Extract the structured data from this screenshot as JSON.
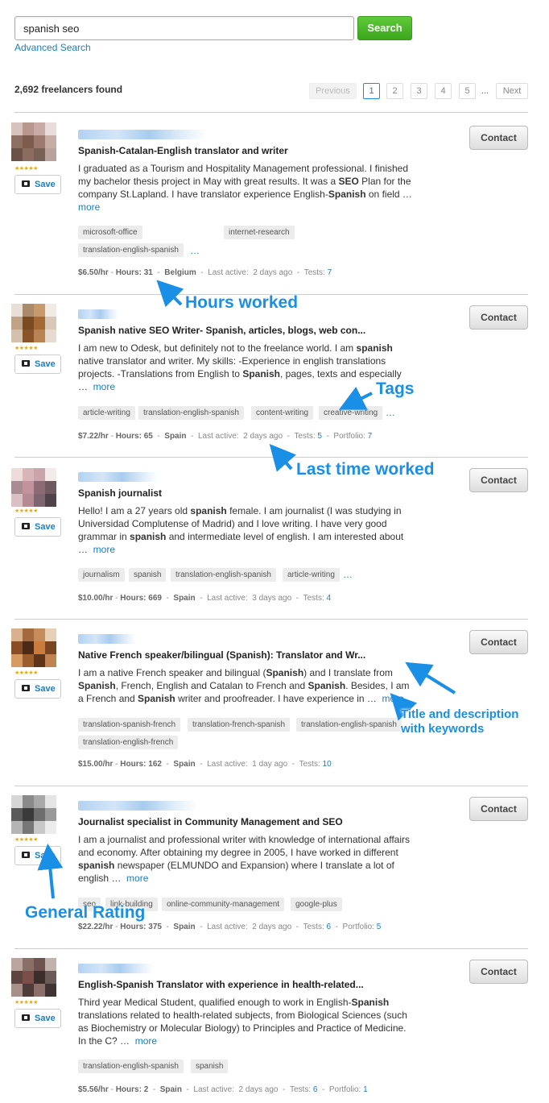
{
  "search": {
    "value": "spanish seo",
    "button": "Search",
    "advanced": "Advanced Search"
  },
  "results_count": "2,692 freelancers found",
  "pager": {
    "previous": "Previous",
    "pages": [
      "1",
      "2",
      "3",
      "4",
      "5"
    ],
    "dots": "...",
    "next": "Next",
    "current": "1"
  },
  "common": {
    "save": "Save",
    "contact": "Contact",
    "more": "more",
    "ellipsis": "…",
    "tags_more": "…",
    "stars": "★★★★★"
  },
  "freelancers": [
    {
      "title": "Spanish-Catalan-English translator and writer",
      "desc": [
        "I graduated as a Tourism and Hospitality Management professional. I finished my bachelor thesis project in May with great results. It was a ",
        "SEO",
        " Plan for the company St.Lapland. I have translator experience English-",
        "Spanish",
        " on field "
      ],
      "tags": [
        "microsoft-office",
        "internet-research",
        "translation-catalan-english",
        "translation-english-spanish"
      ],
      "rate": "$6.50/hr",
      "hours": "Hours: 31",
      "location": "Belgium",
      "last_active": "Last active:",
      "last_active_value": "2 days ago",
      "tests_label": "Tests:",
      "tests": "7"
    },
    {
      "title": "Spanish native SEO Writer- Spanish, articles, blogs, web con...",
      "desc": [
        "I am new to Odesk, but definitely not to the freelance world. I am ",
        "spanish",
        " native translator and writer. My skills: -Experience in english translations projects. -Translations from English to ",
        "Spanish",
        ", pages, texts and especially "
      ],
      "tags": [
        "article-writing",
        "translation-english-spanish",
        "content-writing",
        "creative-writing"
      ],
      "rate": "$7.22/hr",
      "hours": "Hours: 65",
      "location": "Spain",
      "last_active": "Last active:",
      "last_active_value": "2 days ago",
      "tests_label": "Tests:",
      "tests": "5",
      "portfolio_label": "Portfolio:",
      "portfolio": "7"
    },
    {
      "title": "Spanish journalist",
      "desc": [
        "Hello! I am a 27 years old ",
        "spanish",
        " female. I am journalist (I was studying in Universidad Complutense of Madrid) and I love writing. I have very good grammar in ",
        "spanish",
        " and intermediate level of english. I am interested about "
      ],
      "tags": [
        "journalism",
        "spanish",
        "translation-english-spanish",
        "article-writing"
      ],
      "rate": "$10.00/hr",
      "hours": "Hours: 669",
      "location": "Spain",
      "last_active": "Last active:",
      "last_active_value": "3 days ago",
      "tests_label": "Tests:",
      "tests": "4"
    },
    {
      "title": "Native French speaker/bilingual (Spanish): Translator and Wr...",
      "desc": [
        "I am a native French speaker and bilingual (",
        "Spanish",
        ") and I translate from ",
        "Spanish",
        ", French, English and Catalan to French and ",
        "Spanish",
        ". Besides, I am a French and ",
        "Spanish",
        " writer and proofreader. I have experience in "
      ],
      "tags": [
        "translation-spanish-french",
        "translation-french-spanish",
        "translation-english-spanish",
        "translation-english-french"
      ],
      "rate": "$15.00/hr",
      "hours": "Hours: 162",
      "location": "Spain",
      "last_active": "Last active:",
      "last_active_value": "1 day ago",
      "tests_label": "Tests:",
      "tests": "10"
    },
    {
      "title": "Journalist specialist in Community Management and SEO",
      "desc": [
        "I am a journalist and professional writer with knowledge of international affairs and economy. After obtaining my degree in 2005, I have worked in different ",
        "spanish",
        " newspaper (ELMUNDO and Expansion) where I translate a lot of english "
      ],
      "tags": [
        "seo",
        "link-building",
        "online-community-management",
        "google-plus"
      ],
      "rate": "$22.22/hr",
      "hours": "Hours: 375",
      "location": "Spain",
      "last_active": "Last active:",
      "last_active_value": "2 days ago",
      "tests_label": "Tests:",
      "tests": "6",
      "portfolio_label": "Portfolio:",
      "portfolio": "5"
    },
    {
      "title": "English-Spanish Translator with experience in health-related...",
      "desc": [
        "Third year Medical Student, qualified enough to work in English-",
        "Spanish",
        " translations related to health-related subjects, from Biological Sciences (such as Biochemistry or Molecular Biology) to Principles and Practice of Medicine. In the C? "
      ],
      "tags": [
        "translation-english-spanish",
        "spanish"
      ],
      "rate": "$5.56/hr",
      "hours": "Hours: 2",
      "location": "Spain",
      "last_active": "Last active:",
      "last_active_value": "2 days ago",
      "tests_label": "Tests:",
      "tests": "6",
      "portfolio_label": "Portfolio:",
      "portfolio": "1"
    }
  ],
  "annotations": {
    "hours_worked": "Hours worked",
    "tags": "Tags",
    "last_time_worked": "Last time worked",
    "title_desc_1": "Title and description",
    "title_desc_2": "with keywords",
    "general_rating": "General Rating"
  },
  "colors": {
    "link": "#1a7fc1",
    "search_button": "#3ba51c",
    "annotation": "#1a8fe6",
    "stars": "#f0a800"
  }
}
